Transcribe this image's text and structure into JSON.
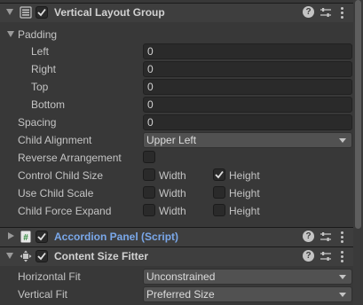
{
  "vertical_layout_group": {
    "title": "Vertical Layout Group",
    "enabled": true,
    "padding": {
      "label": "Padding",
      "left_label": "Left",
      "left_value": "0",
      "right_label": "Right",
      "right_value": "0",
      "top_label": "Top",
      "top_value": "0",
      "bottom_label": "Bottom",
      "bottom_value": "0"
    },
    "spacing_label": "Spacing",
    "spacing_value": "0",
    "child_alignment_label": "Child Alignment",
    "child_alignment_value": "Upper Left",
    "reverse_arrangement_label": "Reverse Arrangement",
    "reverse_arrangement_checked": false,
    "control_child_size_label": "Control Child Size",
    "use_child_scale_label": "Use Child Scale",
    "child_force_expand_label": "Child Force Expand",
    "width_label": "Width",
    "height_label": "Height",
    "control_child_size": {
      "width": false,
      "height": true
    },
    "use_child_scale": {
      "width": false,
      "height": false
    },
    "child_force_expand": {
      "width": false,
      "height": false
    }
  },
  "accordion_panel": {
    "title": "Accordion Panel (Script)",
    "enabled": true
  },
  "content_size_fitter": {
    "title": "Content Size Fitter",
    "enabled": true,
    "horizontal_fit_label": "Horizontal Fit",
    "horizontal_fit_value": "Unconstrained",
    "vertical_fit_label": "Vertical Fit",
    "vertical_fit_value": "Preferred Size"
  },
  "header_buttons": {
    "help": "?"
  },
  "icons": {
    "layout_group": "layout-group-icon",
    "script": "script-icon",
    "fitter": "content-size-fitter-icon",
    "presets": "presets-icon",
    "menu": "kebab-menu-icon",
    "checkmark": "checkmark-icon"
  },
  "colors": {
    "background": "#383838",
    "header": "#3e3e3e",
    "script_title": "#7aa8ea",
    "field": "#2a2a2a",
    "dropdown": "#515151"
  }
}
